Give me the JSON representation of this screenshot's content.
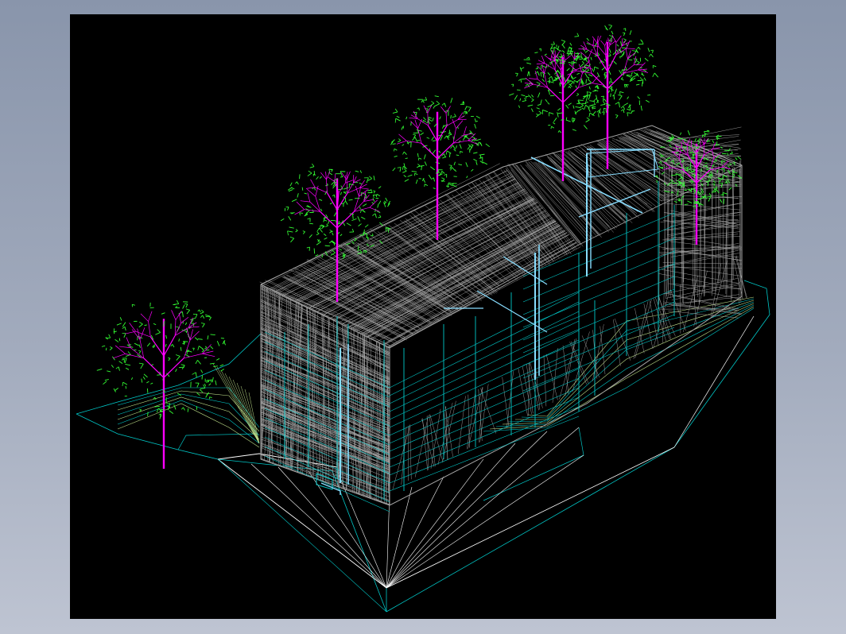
{
  "viewport": {
    "background": "#000000",
    "window_background": "#9aa3b6"
  },
  "layers": [
    {
      "name": "tree-trunks-branches",
      "color": "#ff00ff"
    },
    {
      "name": "tree-foliage",
      "color": "#33ff33"
    },
    {
      "name": "building-facade",
      "color": "#a6a6a6"
    },
    {
      "name": "structure-frame",
      "color": "#00c8c8"
    },
    {
      "name": "frame-highlight",
      "color": "#88ddff"
    },
    {
      "name": "site-outline",
      "color": "#ffffff"
    },
    {
      "name": "terrain-contours",
      "color": "#bfe08a"
    }
  ]
}
